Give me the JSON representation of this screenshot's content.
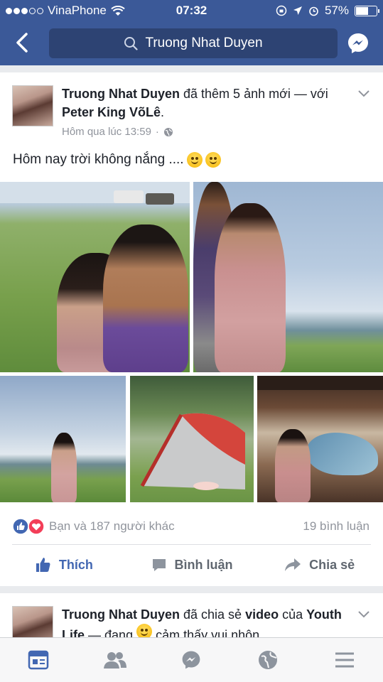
{
  "status_bar": {
    "carrier": "VinaPhone",
    "time": "07:32",
    "battery_percent": "57%",
    "battery_level": 0.57,
    "signal_bars_filled": 3,
    "signal_bars_total": 5
  },
  "nav": {
    "search_text": "Truong Nhat Duyen",
    "back_icon": "chevron-left-icon",
    "messenger_icon": "messenger-icon"
  },
  "post": {
    "author": "Truong Nhat Duyen",
    "action": "đã thêm 5 ảnh mới —",
    "with_prefix": "với",
    "tagged": "Peter King VõLê",
    "tagged_suffix": ".",
    "timestamp": "Hôm qua lúc 13:59",
    "separator": "·",
    "privacy_icon": "globe-icon",
    "caption": "Hôm nay trời không nắng ....",
    "reactions_text": "Bạn và 187 người khác",
    "comments_text": "19 bình luận",
    "actions": [
      {
        "label": "Thích",
        "icon": "thumbs-up-icon"
      },
      {
        "label": "Bình luận",
        "icon": "comment-icon"
      },
      {
        "label": "Chia sẻ",
        "icon": "share-icon"
      }
    ]
  },
  "post2": {
    "author": "Truong Nhat Duyen",
    "action": "đã chia sẻ",
    "object": "video",
    "of": "của",
    "page": "Youth Life",
    "feeling": "— đang",
    "feeling_text": "cảm thấy vui nhộn."
  },
  "tabbar": [
    {
      "name": "news-feed-icon",
      "active": true
    },
    {
      "name": "friends-icon",
      "active": false
    },
    {
      "name": "messenger-icon",
      "active": false
    },
    {
      "name": "globe-icon",
      "active": false
    },
    {
      "name": "menu-icon",
      "active": false
    }
  ],
  "colors": {
    "brand": "#3b5998",
    "like_blue": "#4267b2",
    "muted": "#90949c"
  }
}
